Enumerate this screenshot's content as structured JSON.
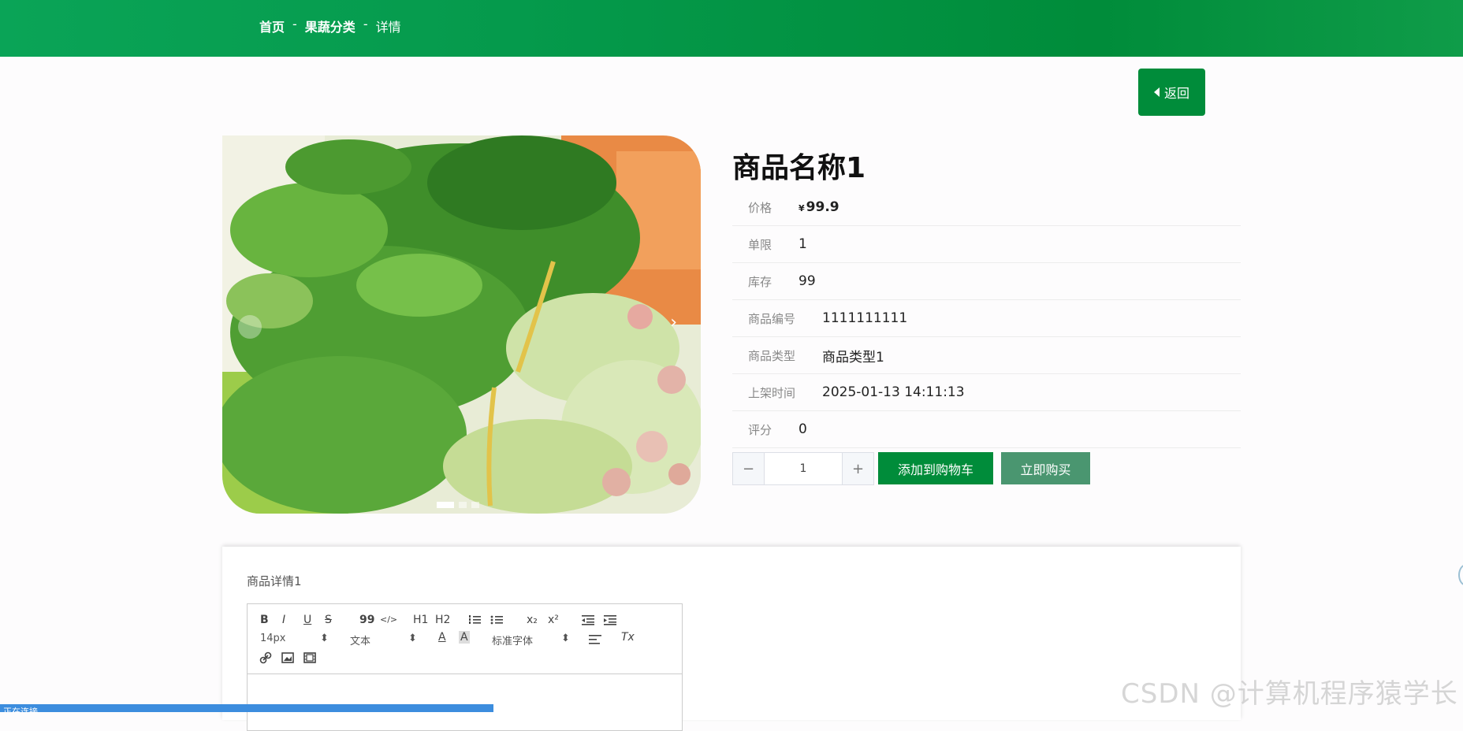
{
  "breadcrumb": {
    "home": "首页",
    "category": "果蔬分类",
    "current": "详情",
    "separator": "-"
  },
  "back_button": "返回",
  "product": {
    "name": "商品名称1",
    "price_label": "价格",
    "currency": "¥",
    "price": "99.9",
    "limit_label": "单限",
    "limit": "1",
    "stock_label": "库存",
    "stock": "99",
    "code_label": "商品编号",
    "code": "1111111111",
    "type_label": "商品类型",
    "type": "商品类型1",
    "time_label": "上架时间",
    "time": "2025-01-13 14:11:13",
    "rating_label": "评分",
    "rating": "0"
  },
  "carousel": {
    "next": "›",
    "slides": 3,
    "active_index": 0
  },
  "quantity": {
    "minus": "−",
    "value": "1",
    "plus": "+"
  },
  "buttons": {
    "add_to_cart": "添加到购物车",
    "buy_now": "立即购买"
  },
  "detail": {
    "label": "商品详情1"
  },
  "editor": {
    "bold": "B",
    "italic": "I",
    "underline": "U",
    "strike": "S",
    "quote": "99",
    "code": "</>",
    "h1": "H1",
    "h2": "H2",
    "sub": "x₂",
    "sup": "x²",
    "size": "14px",
    "format": "文本",
    "font": "标准字体",
    "clean": "Tx"
  },
  "watermark": "CSDN @计算机程序猿学长",
  "status_text": "正在连接..."
}
